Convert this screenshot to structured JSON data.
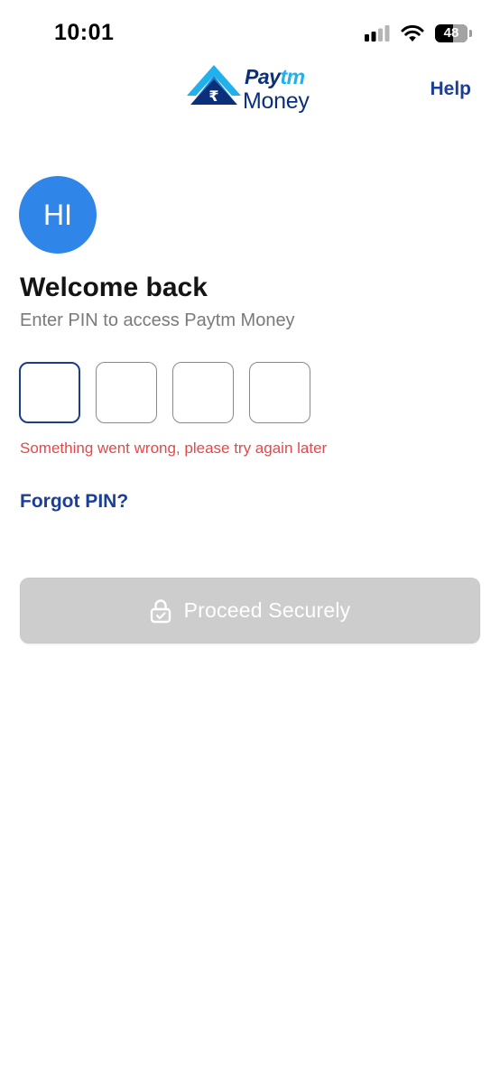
{
  "status_bar": {
    "time": "10:01",
    "battery_level": "48",
    "icons": [
      "signal-icon",
      "wifi-icon",
      "battery-icon"
    ]
  },
  "header": {
    "logo": {
      "line1_pay": "Pay",
      "line1_tm": "tm",
      "line2": "Money",
      "mark_symbol": "₹"
    },
    "help_label": "Help"
  },
  "profile": {
    "initials": "HI",
    "avatar_color": "#2f86e8"
  },
  "login": {
    "title": "Welcome back",
    "subtitle": "Enter PIN to access Paytm Money",
    "pin_length": 4,
    "pin_values": [
      "",
      "",
      "",
      ""
    ],
    "error_message": "Something went wrong, please try again later",
    "forgot_pin_label": "Forgot PIN?",
    "proceed_label": "Proceed Securely"
  },
  "colors": {
    "brand_dark": "#0b2f79",
    "brand_light": "#22b0ec",
    "link": "#1b3f97",
    "error": "#e84747",
    "button_disabled": "#cdcdcd"
  }
}
